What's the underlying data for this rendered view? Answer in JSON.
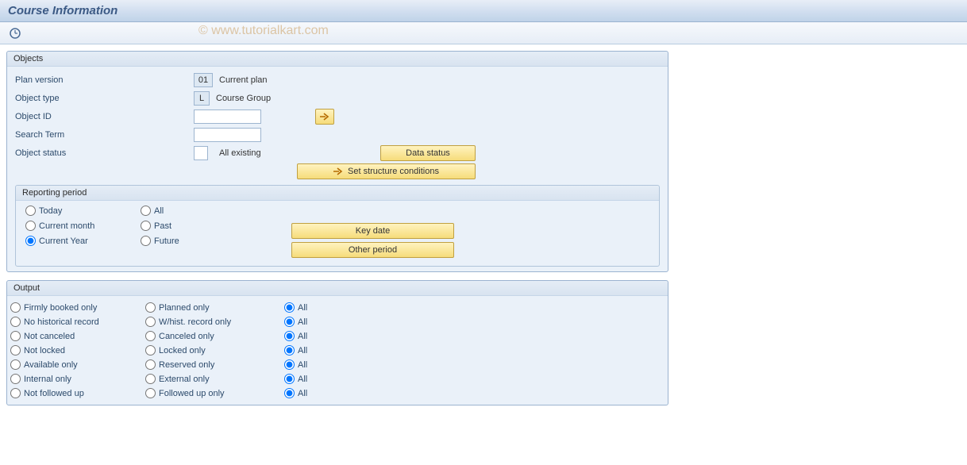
{
  "title": "Course Information",
  "watermark": "© www.tutorialkart.com",
  "objects": {
    "title": "Objects",
    "plan_version_label": "Plan version",
    "plan_version_value": "01",
    "plan_version_desc": "Current plan",
    "object_type_label": "Object type",
    "object_type_value": "L",
    "object_type_desc": "Course Group",
    "object_id_label": "Object ID",
    "object_id_value": "",
    "search_term_label": "Search Term",
    "search_term_value": "",
    "object_status_label": "Object status",
    "object_status_value": "",
    "object_status_desc": "All existing",
    "data_status_btn": "Data status",
    "set_structure_btn": "Set structure conditions"
  },
  "reporting": {
    "title": "Reporting period",
    "today": "Today",
    "current_month": "Current month",
    "current_year": "Current Year",
    "all": "All",
    "past": "Past",
    "future": "Future",
    "key_date_btn": "Key date",
    "other_period_btn": "Other period",
    "selected": "current_year"
  },
  "output": {
    "title": "Output",
    "rows": [
      {
        "a": "Firmly booked only",
        "b": "Planned only",
        "c": "All",
        "sel": "c"
      },
      {
        "a": "No historical record",
        "b": "W/hist. record only",
        "c": "All",
        "sel": "c"
      },
      {
        "a": "Not canceled",
        "b": "Canceled only",
        "c": "All",
        "sel": "c"
      },
      {
        "a": "Not locked",
        "b": "Locked only",
        "c": "All",
        "sel": "c"
      },
      {
        "a": "Available only",
        "b": "Reserved only",
        "c": "All",
        "sel": "c"
      },
      {
        "a": "Internal only",
        "b": "External only",
        "c": "All",
        "sel": "c"
      },
      {
        "a": "Not followed up",
        "b": "Followed up only",
        "c": "All",
        "sel": "c"
      }
    ]
  }
}
